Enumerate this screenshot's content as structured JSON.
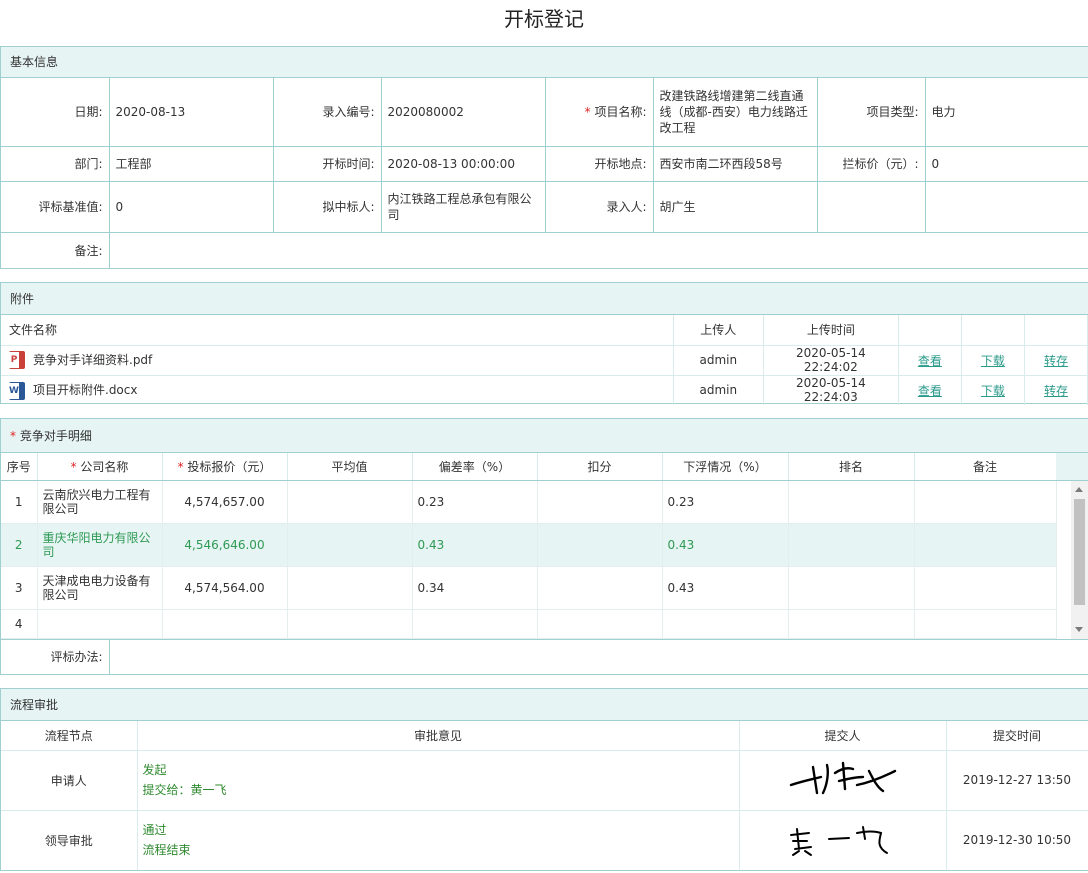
{
  "page_title": "开标登记",
  "basic_info": {
    "section_title": "基本信息",
    "rows": [
      [
        {
          "label": "日期:",
          "value": "2020-08-13"
        },
        {
          "label": "录入编号:",
          "value": "2020080002"
        },
        {
          "label": "项目名称:",
          "value": "改建铁路线增建第二线直通线（成都-西安）电力线路迁改工程",
          "required": true
        },
        {
          "label": "项目类型:",
          "value": "电力"
        }
      ],
      [
        {
          "label": "部门:",
          "value": "工程部"
        },
        {
          "label": "开标时间:",
          "value": "2020-08-13 00:00:00"
        },
        {
          "label": "开标地点:",
          "value": "西安市南二环西段58号"
        },
        {
          "label": "拦标价（元）:",
          "value": "0"
        }
      ],
      [
        {
          "label": "评标基准值:",
          "value": "0"
        },
        {
          "label": "拟中标人:",
          "value": "内江铁路工程总承包有限公司"
        },
        {
          "label": "录入人:",
          "value": "胡广生"
        },
        {
          "label": "",
          "value": ""
        }
      ]
    ],
    "remark_label": "备注:",
    "remark_value": ""
  },
  "attachments": {
    "section_title": "附件",
    "headers": {
      "name": "文件名称",
      "uploader": "上传人",
      "time": "上传时间"
    },
    "files": [
      {
        "icon": "pdf-file-icon",
        "icon_glyph": "P",
        "name": "竞争对手详细资料.pdf",
        "uploader": "admin",
        "time": "2020-05-14 22:24:02",
        "view": "查看",
        "download": "下载",
        "save": "转存"
      },
      {
        "icon": "word-file-icon",
        "icon_glyph": "W",
        "name": "项目开标附件.docx",
        "uploader": "admin",
        "time": "2020-05-14 22:24:03",
        "view": "查看",
        "download": "下载",
        "save": "转存"
      }
    ]
  },
  "competitors": {
    "section_title": "竞争对手明细",
    "headers": [
      "序号",
      "公司名称",
      "投标报价（元）",
      "平均值",
      "偏差率（%）",
      "扣分",
      "下浮情况（%）",
      "排名",
      "备注"
    ],
    "rows": [
      {
        "no": "1",
        "company": "云南欣兴电力工程有限公司",
        "bid": "4,574,657.00",
        "avg": "",
        "deviation": "0.23",
        "deduct": "",
        "float": "0.23",
        "rank": "",
        "remark": ""
      },
      {
        "no": "2",
        "company": "重庆华阳电力有限公司",
        "bid": "4,546,646.00",
        "avg": "",
        "deviation": "0.43",
        "deduct": "",
        "float": "0.43",
        "rank": "",
        "remark": "",
        "selected": true
      },
      {
        "no": "3",
        "company": "天津成电电力设备有限公司",
        "bid": "4,574,564.00",
        "avg": "",
        "deviation": "0.34",
        "deduct": "",
        "float": "0.43",
        "rank": "",
        "remark": ""
      },
      {
        "no": "4",
        "company": "",
        "bid": "",
        "avg": "",
        "deviation": "",
        "deduct": "",
        "float": "",
        "rank": "",
        "remark": ""
      }
    ],
    "method_label": "评标办法:",
    "method_value": ""
  },
  "flow": {
    "section_title": "流程审批",
    "headers": {
      "node": "流程节点",
      "opinion": "审批意见",
      "submitter": "提交人",
      "time": "提交时间"
    },
    "rows": [
      {
        "node": "申请人",
        "opinion_line1": "发起",
        "opinion_line2": "提交给：黄一飞",
        "signature": "胡广生",
        "time": "2019-12-27 13:50"
      },
      {
        "node": "领导审批",
        "opinion_line1": "通过",
        "opinion_line2": "流程结束",
        "signature": "黄一飞",
        "time": "2019-12-30 10:50"
      }
    ]
  },
  "colors": {
    "border": "#9fcfcf",
    "header_bg": "#e6f4f3",
    "link": "#2a9a8a",
    "green_text": "#2f8a2f"
  }
}
